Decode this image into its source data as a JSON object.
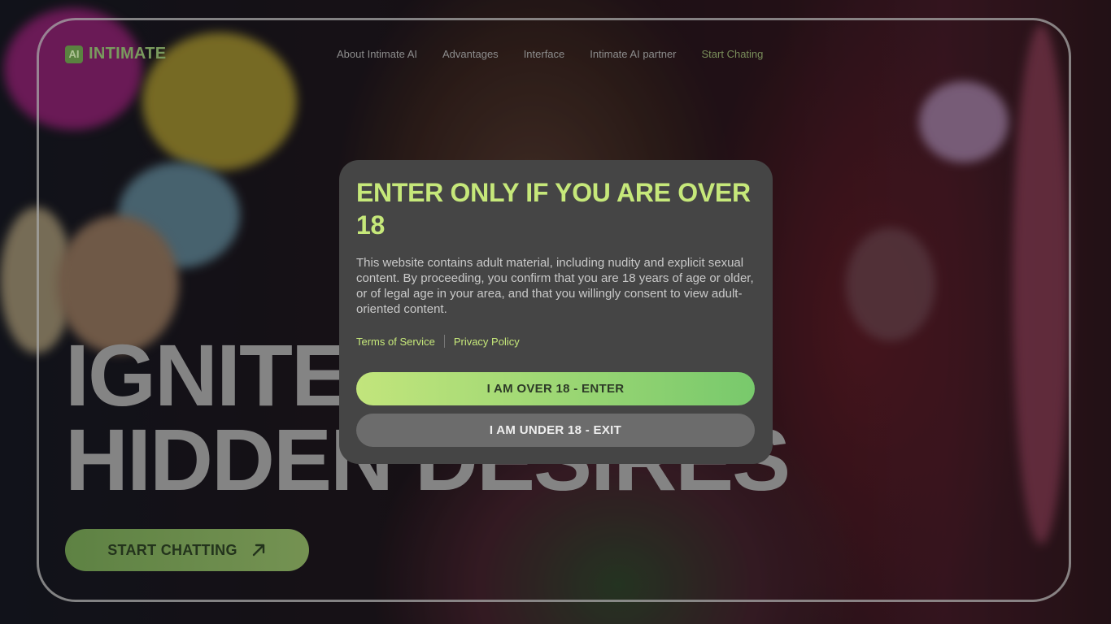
{
  "brand": {
    "logo_mark": "AI",
    "name": "INTIMATE"
  },
  "nav": {
    "items": [
      {
        "label": "About Intimate AI",
        "active": false
      },
      {
        "label": "Advantages",
        "active": false
      },
      {
        "label": "Interface",
        "active": false
      },
      {
        "label": "Intimate AI partner",
        "active": false
      },
      {
        "label": "Start Chating",
        "active": true
      }
    ]
  },
  "hero": {
    "line1": "IGNITE",
    "line2": "HIDDEN DESIRES",
    "cta_label": "START CHATTING",
    "cta_icon": "arrow-up-right-icon"
  },
  "age_gate": {
    "title": "ENTER ONLY IF YOU ARE OVER 18",
    "body": "This website contains adult material, including nudity and explicit sexual content. By proceeding, you confirm that you are 18 years of age or older, or of legal age in your area, and that you willingly consent to view adult-oriented content.",
    "links": {
      "terms": "Terms of Service",
      "privacy": "Privacy Policy"
    },
    "enter_label": "I AM OVER 18 - ENTER",
    "exit_label": "I AM UNDER 18 - EXIT"
  },
  "colors": {
    "accent": "#c6e87a",
    "modal_bg": "#454545",
    "enter_gradient_start": "#c2e57c",
    "enter_gradient_end": "#78c96c",
    "exit_bg": "#6c6c6c"
  }
}
